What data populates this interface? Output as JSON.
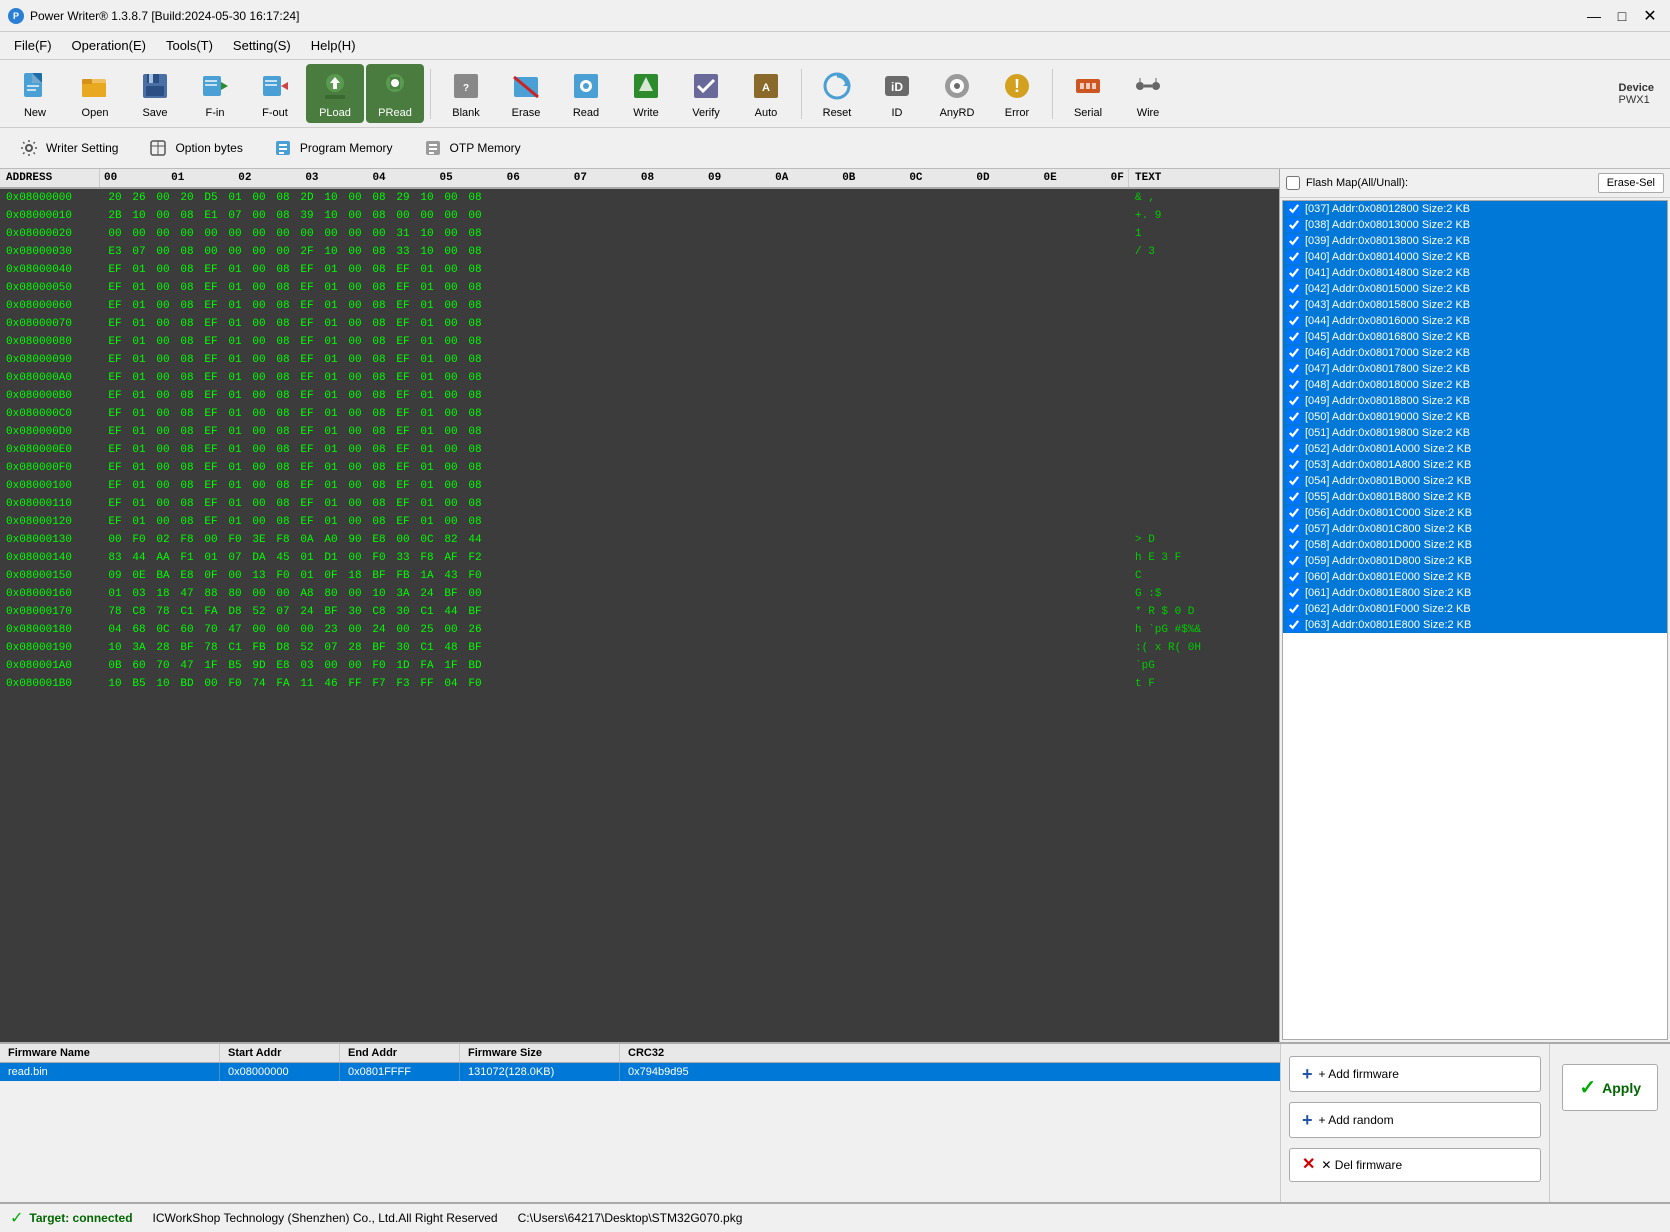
{
  "title_bar": {
    "title": "Power Writer® 1.3.8.7 [Build:2024-05-30 16:17:24]",
    "min_btn": "—",
    "max_btn": "□"
  },
  "menu": {
    "items": [
      "File(F)",
      "Operation(E)",
      "Tools(T)",
      "Setting(S)",
      "Help(H)"
    ]
  },
  "toolbar": {
    "buttons": [
      {
        "id": "new",
        "label": "New"
      },
      {
        "id": "open",
        "label": "Open"
      },
      {
        "id": "save",
        "label": "Save"
      },
      {
        "id": "fin",
        "label": "F-in"
      },
      {
        "id": "fout",
        "label": "F-out"
      },
      {
        "id": "pload",
        "label": "PLoad"
      },
      {
        "id": "pread",
        "label": "PRead"
      },
      {
        "id": "blank",
        "label": "Blank"
      },
      {
        "id": "erase",
        "label": "Erase"
      },
      {
        "id": "read",
        "label": "Read"
      },
      {
        "id": "write",
        "label": "Write"
      },
      {
        "id": "verify",
        "label": "Verify"
      },
      {
        "id": "auto",
        "label": "Auto"
      },
      {
        "id": "reset",
        "label": "Reset"
      },
      {
        "id": "id",
        "label": "ID"
      },
      {
        "id": "anyrd",
        "label": "AnyRD"
      },
      {
        "id": "error",
        "label": "Error"
      },
      {
        "id": "serial",
        "label": "Serial"
      },
      {
        "id": "wire",
        "label": "Wire"
      }
    ],
    "device_label": "Device",
    "device_value": "PWX1"
  },
  "toolbar2": {
    "buttons": [
      {
        "id": "writer-setting",
        "label": "Writer Setting"
      },
      {
        "id": "option-bytes",
        "label": "Option bytes"
      },
      {
        "id": "program-memory",
        "label": "Program Memory"
      },
      {
        "id": "otp-memory",
        "label": "OTP Memory"
      }
    ]
  },
  "hex_view": {
    "column_headers": [
      "ADDRESS",
      "00",
      "01",
      "02",
      "03",
      "04",
      "05",
      "06",
      "07",
      "08",
      "09",
      "0A",
      "0B",
      "0C",
      "0D",
      "0E",
      "0F",
      "TEXT"
    ],
    "rows": [
      {
        "addr": "0x08000000",
        "bytes": [
          "20",
          "26",
          "00",
          "20",
          "D5",
          "01",
          "00",
          "08",
          "2D",
          "10",
          "00",
          "08",
          "29",
          "10",
          "00",
          "08"
        ],
        "text": "& ,"
      },
      {
        "addr": "0x08000010",
        "bytes": [
          "2B",
          "10",
          "00",
          "08",
          "E1",
          "07",
          "00",
          "08",
          "39",
          "10",
          "00",
          "08",
          "00",
          "00",
          "00",
          "00"
        ],
        "text": "+.  9"
      },
      {
        "addr": "0x08000020",
        "bytes": [
          "00",
          "00",
          "00",
          "00",
          "00",
          "00",
          "00",
          "00",
          "00",
          "00",
          "00",
          "00",
          "31",
          "10",
          "00",
          "08"
        ],
        "text": "     1"
      },
      {
        "addr": "0x08000030",
        "bytes": [
          "E3",
          "07",
          "00",
          "08",
          "00",
          "00",
          "00",
          "00",
          "2F",
          "10",
          "00",
          "08",
          "33",
          "10",
          "00",
          "08"
        ],
        "text": "  /  3"
      },
      {
        "addr": "0x08000040",
        "bytes": [
          "EF",
          "01",
          "00",
          "08",
          "EF",
          "01",
          "00",
          "08",
          "EF",
          "01",
          "00",
          "08",
          "EF",
          "01",
          "00",
          "08"
        ],
        "text": ""
      },
      {
        "addr": "0x08000050",
        "bytes": [
          "EF",
          "01",
          "00",
          "08",
          "EF",
          "01",
          "00",
          "08",
          "EF",
          "01",
          "00",
          "08",
          "EF",
          "01",
          "00",
          "08"
        ],
        "text": ""
      },
      {
        "addr": "0x08000060",
        "bytes": [
          "EF",
          "01",
          "00",
          "08",
          "EF",
          "01",
          "00",
          "08",
          "EF",
          "01",
          "00",
          "08",
          "EF",
          "01",
          "00",
          "08"
        ],
        "text": ""
      },
      {
        "addr": "0x08000070",
        "bytes": [
          "EF",
          "01",
          "00",
          "08",
          "EF",
          "01",
          "00",
          "08",
          "EF",
          "01",
          "00",
          "08",
          "EF",
          "01",
          "00",
          "08"
        ],
        "text": ""
      },
      {
        "addr": "0x08000080",
        "bytes": [
          "EF",
          "01",
          "00",
          "08",
          "EF",
          "01",
          "00",
          "08",
          "EF",
          "01",
          "00",
          "08",
          "EF",
          "01",
          "00",
          "08"
        ],
        "text": ""
      },
      {
        "addr": "0x08000090",
        "bytes": [
          "EF",
          "01",
          "00",
          "08",
          "EF",
          "01",
          "00",
          "08",
          "EF",
          "01",
          "00",
          "08",
          "EF",
          "01",
          "00",
          "08"
        ],
        "text": ""
      },
      {
        "addr": "0x080000A0",
        "bytes": [
          "EF",
          "01",
          "00",
          "08",
          "EF",
          "01",
          "00",
          "08",
          "EF",
          "01",
          "00",
          "08",
          "EF",
          "01",
          "00",
          "08"
        ],
        "text": ""
      },
      {
        "addr": "0x080000B0",
        "bytes": [
          "EF",
          "01",
          "00",
          "08",
          "EF",
          "01",
          "00",
          "08",
          "EF",
          "01",
          "00",
          "08",
          "EF",
          "01",
          "00",
          "08"
        ],
        "text": ""
      },
      {
        "addr": "0x080000C0",
        "bytes": [
          "EF",
          "01",
          "00",
          "08",
          "EF",
          "01",
          "00",
          "08",
          "EF",
          "01",
          "00",
          "08",
          "EF",
          "01",
          "00",
          "08"
        ],
        "text": ""
      },
      {
        "addr": "0x080000D0",
        "bytes": [
          "EF",
          "01",
          "00",
          "08",
          "EF",
          "01",
          "00",
          "08",
          "EF",
          "01",
          "00",
          "08",
          "EF",
          "01",
          "00",
          "08"
        ],
        "text": ""
      },
      {
        "addr": "0x080000E0",
        "bytes": [
          "EF",
          "01",
          "00",
          "08",
          "EF",
          "01",
          "00",
          "08",
          "EF",
          "01",
          "00",
          "08",
          "EF",
          "01",
          "00",
          "08"
        ],
        "text": ""
      },
      {
        "addr": "0x080000F0",
        "bytes": [
          "EF",
          "01",
          "00",
          "08",
          "EF",
          "01",
          "00",
          "08",
          "EF",
          "01",
          "00",
          "08",
          "EF",
          "01",
          "00",
          "08"
        ],
        "text": ""
      },
      {
        "addr": "0x08000100",
        "bytes": [
          "EF",
          "01",
          "00",
          "08",
          "EF",
          "01",
          "00",
          "08",
          "EF",
          "01",
          "00",
          "08",
          "EF",
          "01",
          "00",
          "08"
        ],
        "text": ""
      },
      {
        "addr": "0x08000110",
        "bytes": [
          "EF",
          "01",
          "00",
          "08",
          "EF",
          "01",
          "00",
          "08",
          "EF",
          "01",
          "00",
          "08",
          "EF",
          "01",
          "00",
          "08"
        ],
        "text": ""
      },
      {
        "addr": "0x08000120",
        "bytes": [
          "EF",
          "01",
          "00",
          "08",
          "EF",
          "01",
          "00",
          "08",
          "EF",
          "01",
          "00",
          "08",
          "EF",
          "01",
          "00",
          "08"
        ],
        "text": ""
      },
      {
        "addr": "0x08000130",
        "bytes": [
          "00",
          "F0",
          "02",
          "F8",
          "00",
          "F0",
          "3E",
          "F8",
          "0A",
          "A0",
          "90",
          "E8",
          "00",
          "0C",
          "82",
          "44"
        ],
        "text": "  >  D"
      },
      {
        "addr": "0x08000140",
        "bytes": [
          "83",
          "44",
          "AA",
          "F1",
          "01",
          "07",
          "DA",
          "45",
          "01",
          "D1",
          "00",
          "F0",
          "33",
          "F8",
          "AF",
          "F2"
        ],
        "text": "h  E  3  F"
      },
      {
        "addr": "0x08000150",
        "bytes": [
          "09",
          "0E",
          "BA",
          "E8",
          "0F",
          "00",
          "13",
          "F0",
          "01",
          "0F",
          "18",
          "BF",
          "FB",
          "1A",
          "43",
          "F0"
        ],
        "text": "  C"
      },
      {
        "addr": "0x08000160",
        "bytes": [
          "01",
          "03",
          "18",
          "47",
          "88",
          "80",
          "00",
          "00",
          "A8",
          "80",
          "00",
          "10",
          "3A",
          "24",
          "BF",
          "00"
        ],
        "text": "G  :$"
      },
      {
        "addr": "0x08000170",
        "bytes": [
          "78",
          "C8",
          "78",
          "C1",
          "FA",
          "D8",
          "52",
          "07",
          "24",
          "BF",
          "30",
          "C8",
          "30",
          "C1",
          "44",
          "BF"
        ],
        "text": "* R $ 0 D"
      },
      {
        "addr": "0x08000180",
        "bytes": [
          "04",
          "68",
          "0C",
          "60",
          "70",
          "47",
          "00",
          "00",
          "00",
          "23",
          "00",
          "24",
          "00",
          "25",
          "00",
          "26"
        ],
        "text": "h `pG  #$%&"
      },
      {
        "addr": "0x08000190",
        "bytes": [
          "10",
          "3A",
          "28",
          "BF",
          "78",
          "C1",
          "FB",
          "D8",
          "52",
          "07",
          "28",
          "BF",
          "30",
          "C1",
          "48",
          "BF"
        ],
        "text": ":( x R( 0H"
      },
      {
        "addr": "0x080001A0",
        "bytes": [
          "0B",
          "60",
          "70",
          "47",
          "1F",
          "B5",
          "9D",
          "E8",
          "03",
          "00",
          "00",
          "F0",
          "1D",
          "FA",
          "1F",
          "BD"
        ],
        "text": "`pG"
      },
      {
        "addr": "0x080001B0",
        "bytes": [
          "10",
          "B5",
          "10",
          "BD",
          "00",
          "F0",
          "74",
          "FA",
          "11",
          "46",
          "FF",
          "F7",
          "F3",
          "FF",
          "04",
          "F0"
        ],
        "text": "  t  F"
      }
    ]
  },
  "flash_map": {
    "header": "Flash Map(All/Unall):",
    "erase_sel_btn": "Erase-Sel",
    "items": [
      {
        "id": 37,
        "label": "[037] Addr:0x08012800 Size:2 KB",
        "checked": true
      },
      {
        "id": 38,
        "label": "[038] Addr:0x08013000 Size:2 KB",
        "checked": true
      },
      {
        "id": 39,
        "label": "[039] Addr:0x08013800 Size:2 KB",
        "checked": true
      },
      {
        "id": 40,
        "label": "[040] Addr:0x08014000 Size:2 KB",
        "checked": true
      },
      {
        "id": 41,
        "label": "[041] Addr:0x08014800 Size:2 KB",
        "checked": true
      },
      {
        "id": 42,
        "label": "[042] Addr:0x08015000 Size:2 KB",
        "checked": true
      },
      {
        "id": 43,
        "label": "[043] Addr:0x08015800 Size:2 KB",
        "checked": true
      },
      {
        "id": 44,
        "label": "[044] Addr:0x08016000 Size:2 KB",
        "checked": true
      },
      {
        "id": 45,
        "label": "[045] Addr:0x08016800 Size:2 KB",
        "checked": true
      },
      {
        "id": 46,
        "label": "[046] Addr:0x08017000 Size:2 KB",
        "checked": true
      },
      {
        "id": 47,
        "label": "[047] Addr:0x08017800 Size:2 KB",
        "checked": true
      },
      {
        "id": 48,
        "label": "[048] Addr:0x08018000 Size:2 KB",
        "checked": true
      },
      {
        "id": 49,
        "label": "[049] Addr:0x08018800 Size:2 KB",
        "checked": true
      },
      {
        "id": 50,
        "label": "[050] Addr:0x08019000 Size:2 KB",
        "checked": true
      },
      {
        "id": 51,
        "label": "[051] Addr:0x08019800 Size:2 KB",
        "checked": true
      },
      {
        "id": 52,
        "label": "[052] Addr:0x0801A000 Size:2 KB",
        "checked": true
      },
      {
        "id": 53,
        "label": "[053] Addr:0x0801A800 Size:2 KB",
        "checked": true
      },
      {
        "id": 54,
        "label": "[054] Addr:0x0801B000 Size:2 KB",
        "checked": true
      },
      {
        "id": 55,
        "label": "[055] Addr:0x0801B800 Size:2 KB",
        "checked": true
      },
      {
        "id": 56,
        "label": "[056] Addr:0x0801C000 Size:2 KB",
        "checked": true
      },
      {
        "id": 57,
        "label": "[057] Addr:0x0801C800 Size:2 KB",
        "checked": true
      },
      {
        "id": 58,
        "label": "[058] Addr:0x0801D000 Size:2 KB",
        "checked": true
      },
      {
        "id": 59,
        "label": "[059] Addr:0x0801D800 Size:2 KB",
        "checked": true
      },
      {
        "id": 60,
        "label": "[060] Addr:0x0801E000 Size:2 KB",
        "checked": true
      },
      {
        "id": 61,
        "label": "[061] Addr:0x0801E800 Size:2 KB",
        "checked": true
      },
      {
        "id": 62,
        "label": "[062] Addr:0x0801F000 Size:2 KB",
        "checked": true
      },
      {
        "id": 63,
        "label": "[063] Addr:0x0801E800 Size:2 KB",
        "checked": true
      }
    ]
  },
  "firmware_table": {
    "columns": [
      "Firmware Name",
      "Start Addr",
      "End Addr",
      "Firmware Size",
      "CRC32"
    ],
    "rows": [
      {
        "name": "read.bin",
        "start": "0x08000000",
        "end": "0x0801FFFF",
        "size": "131072(128.0KB)",
        "crc": "0x794b9d95",
        "selected": true
      }
    ]
  },
  "right_buttons": {
    "add_firmware": "+ Add firmware",
    "add_random": "+ Add random",
    "del_firmware": "✕ Del firmware",
    "apply": "Apply"
  },
  "status_bar": {
    "connected": "Target: connected",
    "copyright": "ICWorkShop Technology (Shenzhen) Co., Ltd.All Right Reserved",
    "file_path": "C:\\Users\\64217\\Desktop\\STM32G070.pkg"
  }
}
